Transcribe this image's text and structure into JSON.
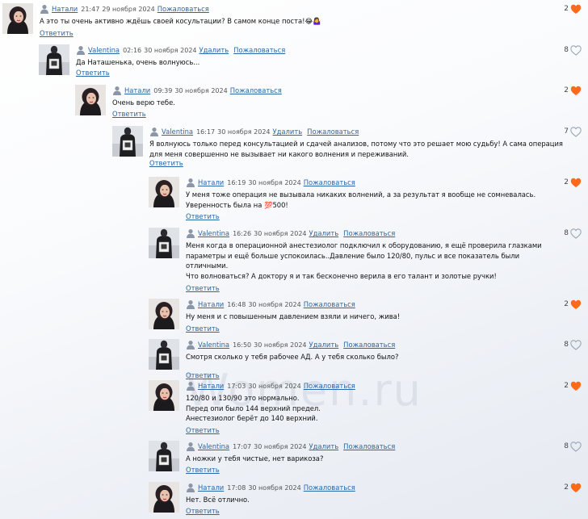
{
  "colors": {
    "link": "#2a67a6",
    "heart_filled": "#ff6a1a",
    "heart_empty": "#9aa7b8"
  },
  "watermark": "Women.ru",
  "comments": [
    {
      "author": "Натали",
      "time": "21:47",
      "date": "29 ноября 2024",
      "actions": [
        "Пожаловаться"
      ],
      "text": [
        "А это ты очень активно ждёшь своей косультации? В самом конце поста!😂🤷‍♀️"
      ],
      "reply": "Ответить",
      "likes": "2",
      "liked": true
    },
    {
      "author": "Valentina",
      "time": "02:16",
      "date": "30 ноября 2024",
      "actions": [
        "Удалить",
        "Пожаловаться"
      ],
      "text": [
        "Да Наташенька, очень волнуюсь..."
      ],
      "reply": "Ответить",
      "likes": "8",
      "liked": false
    },
    {
      "author": "Натали",
      "time": "09:39",
      "date": "30 ноября 2024",
      "actions": [
        "Пожаловаться"
      ],
      "text": [
        "Очень верю тебе."
      ],
      "reply": "Ответить",
      "likes": "2",
      "liked": true
    },
    {
      "author": "Valentina",
      "time": "16:17",
      "date": "30 ноября 2024",
      "actions": [
        "Удалить",
        "Пожаловаться"
      ],
      "text": [
        "Я волнуюсь только перед консультацией и сдачей анализов, потому что это решает мою судьбу! А сама операция",
        "для меня совершенно не вызывает ни какого волнения и переживаний."
      ],
      "reply": "Ответить",
      "likes": "7",
      "liked": false
    },
    {
      "author": "Натали",
      "time": "16:19",
      "date": "30 ноября 2024",
      "actions": [
        "Пожаловаться"
      ],
      "text": [
        "У меня тоже операция не вызывала никаких волнений, а за результат я вообще не сомневалась.",
        "Уверенность была на 💯500!"
      ],
      "reply": "Ответить",
      "likes": "2",
      "liked": true
    },
    {
      "author": "Valentina",
      "time": "16:26",
      "date": "30 ноября 2024",
      "actions": [
        "Удалить",
        "Пожаловаться"
      ],
      "text": [
        "Меня когда в операционной анестезиолог подключил к оборудованию, я ещё проверила глазками",
        "параметры и ещё больше успокоилась..Давление было 120/80, пульс и все показатель были",
        "отличными.",
        "Что волноваться? А доктору я и так бесконечно верила в его талант и золотые ручки!"
      ],
      "reply": "Ответить",
      "likes": "8",
      "liked": false
    },
    {
      "author": "Натали",
      "time": "16:48",
      "date": "30 ноября 2024",
      "actions": [
        "Пожаловаться"
      ],
      "text": [
        "Ну меня и с повышенным давлением взяли и ничего, жива!"
      ],
      "reply": "Ответить",
      "likes": "2",
      "liked": true
    },
    {
      "author": "Valentina",
      "time": "16:50",
      "date": "30 ноября 2024",
      "actions": [
        "Удалить",
        "Пожаловаться"
      ],
      "text": [
        "Смотря сколько у тебя рабочее АД. А у тебя сколько было?"
      ],
      "reply": "Ответить",
      "likes": "8",
      "liked": false
    },
    {
      "author": "Натали",
      "time": "17:03",
      "date": "30 ноября 2024",
      "actions": [
        "Пожаловаться"
      ],
      "text": [
        "120/80 и 130/90 это нормально.",
        "Перед опи было 144 верхний предел.",
        "Анестезиолог берёт до 140 верхний."
      ],
      "reply": "Ответить",
      "likes": "2",
      "liked": true
    },
    {
      "author": "Valentina",
      "time": "17:07",
      "date": "30 ноября 2024",
      "actions": [
        "Удалить",
        "Пожаловаться"
      ],
      "text": [
        "А ножки у тебя чистые, нет варикоза?"
      ],
      "reply": "Ответить",
      "likes": "8",
      "liked": false
    },
    {
      "author": "Натали",
      "time": "17:08",
      "date": "30 ноября 2024",
      "actions": [
        "Пожаловаться"
      ],
      "text": [
        "Нет. Всё отлично."
      ],
      "reply": "Ответить",
      "likes": "2",
      "liked": true
    }
  ]
}
